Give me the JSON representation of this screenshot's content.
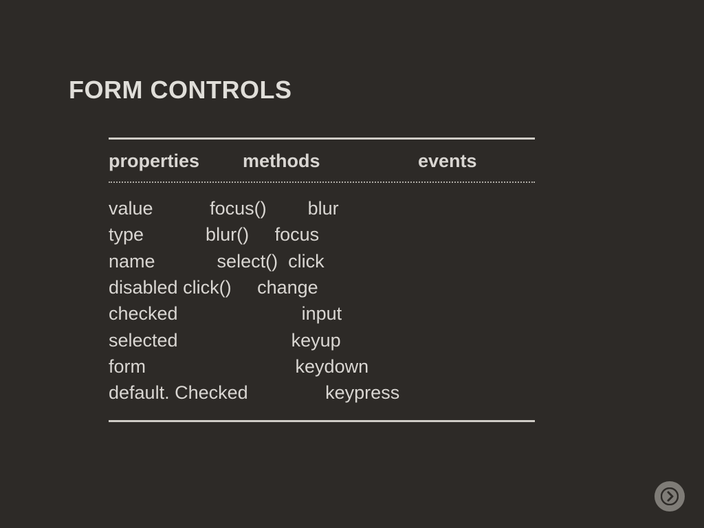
{
  "title": "FORM CONTROLS",
  "headers": {
    "h0": "properties",
    "h1": "methods",
    "h2": "events"
  },
  "lines": {
    "l0": "value           focus()        blur",
    "l1": "type            blur()     focus",
    "l2": "name            select()  click",
    "l3": "disabled click()     change",
    "l4": "checked                        input",
    "l5": "selected                      keyup",
    "l6": "form                             keydown",
    "l7": "default. Checked               keypress"
  },
  "chart_data": {
    "type": "table",
    "title": "FORM CONTROLS",
    "columns": [
      "properties",
      "methods",
      "events"
    ],
    "rows": [
      [
        "value",
        "focus()",
        "blur"
      ],
      [
        "type",
        "blur()",
        "focus"
      ],
      [
        "name",
        "select()",
        "click"
      ],
      [
        "disabled",
        "click()",
        "change"
      ],
      [
        "checked",
        "",
        "input"
      ],
      [
        "selected",
        "",
        "keyup"
      ],
      [
        "form",
        "",
        "keydown"
      ],
      [
        "default.Checked",
        "",
        "keypress"
      ]
    ]
  }
}
